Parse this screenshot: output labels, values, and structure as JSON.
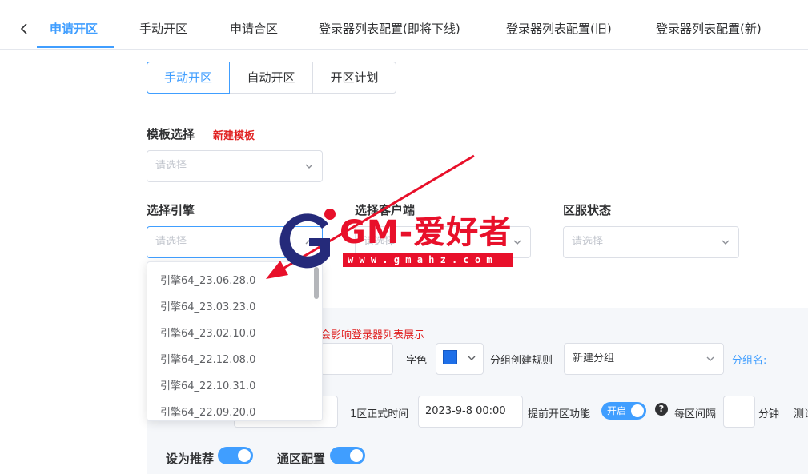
{
  "tabs": [
    {
      "label": "申请开区",
      "active": true
    },
    {
      "label": "手动开区"
    },
    {
      "label": "申请合区"
    },
    {
      "label": "登录器列表配置(即将下线)"
    },
    {
      "label": "登录器列表配置(旧)"
    },
    {
      "label": "登录器列表配置(新)"
    }
  ],
  "modes": [
    "手动开区",
    "自动开区",
    "开区计划"
  ],
  "template": {
    "label": "模板选择",
    "new_link": "新建模板",
    "placeholder": "请选择"
  },
  "engine": {
    "label": "选择引擎",
    "placeholder": "请选择"
  },
  "client": {
    "label": "选择客户端",
    "placeholder": "请选择"
  },
  "server_status": {
    "label": "区服状态",
    "placeholder": "请选择"
  },
  "engine_options": [
    "引擎64_23.06.28.0",
    "引擎64_23.03.23.0",
    "引擎64_23.02.10.0",
    "引擎64_22.12.08.0",
    "引擎64_22.10.31.0",
    "引擎64_22.09.20.0"
  ],
  "form": {
    "warning": "会影响登录器列表展示",
    "color_label": "字色",
    "color_value": "#1e6fe8",
    "group_rule_label": "分组创建规则",
    "group_rule_value": "新建分组",
    "group_name_link": "分组名:",
    "first_zone_time_label": "1区正式时间",
    "first_zone_time_value": "2023-9-8 00:00",
    "early_open_label": "提前开区功能",
    "early_open_switch": "开启",
    "interval_label": "每区间隔",
    "interval_unit": "分钟",
    "test_label": "测试",
    "recommend_label": "设为推荐",
    "cross_config_label": "通区配置"
  },
  "watermark": {
    "text": "GM-爱好者",
    "url": "w w w . g m a h z . c o m"
  },
  "colors": {
    "accent": "#409eff",
    "warning_red": "#e02020",
    "watermark_red": "#e8102a",
    "watermark_navy": "#252a7a"
  }
}
